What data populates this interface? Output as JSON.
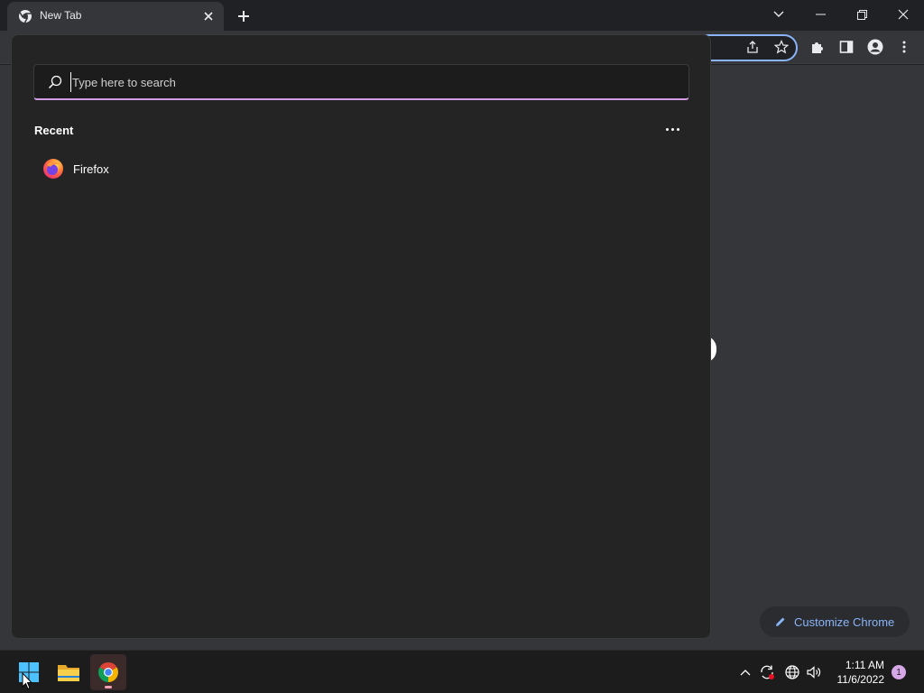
{
  "browser": {
    "tab_title": "New Tab",
    "customize_label": "Customize Chrome"
  },
  "start_menu": {
    "search_placeholder": "Type here to search",
    "recent_heading": "Recent",
    "recent_items": [
      {
        "label": "Firefox",
        "icon": "firefox-icon"
      }
    ]
  },
  "taskbar": {
    "apps": [
      {
        "name": "start",
        "icon": "windows-logo-icon"
      },
      {
        "name": "file-explorer",
        "icon": "folder-icon"
      },
      {
        "name": "chrome",
        "icon": "chrome-icon"
      }
    ],
    "time": "1:11 AM",
    "date": "11/6/2022",
    "notification_count": "1"
  },
  "colors": {
    "accent": "#8ab4f8",
    "search_underline": "#d29be3",
    "notification_badge": "#d7a8e8"
  }
}
